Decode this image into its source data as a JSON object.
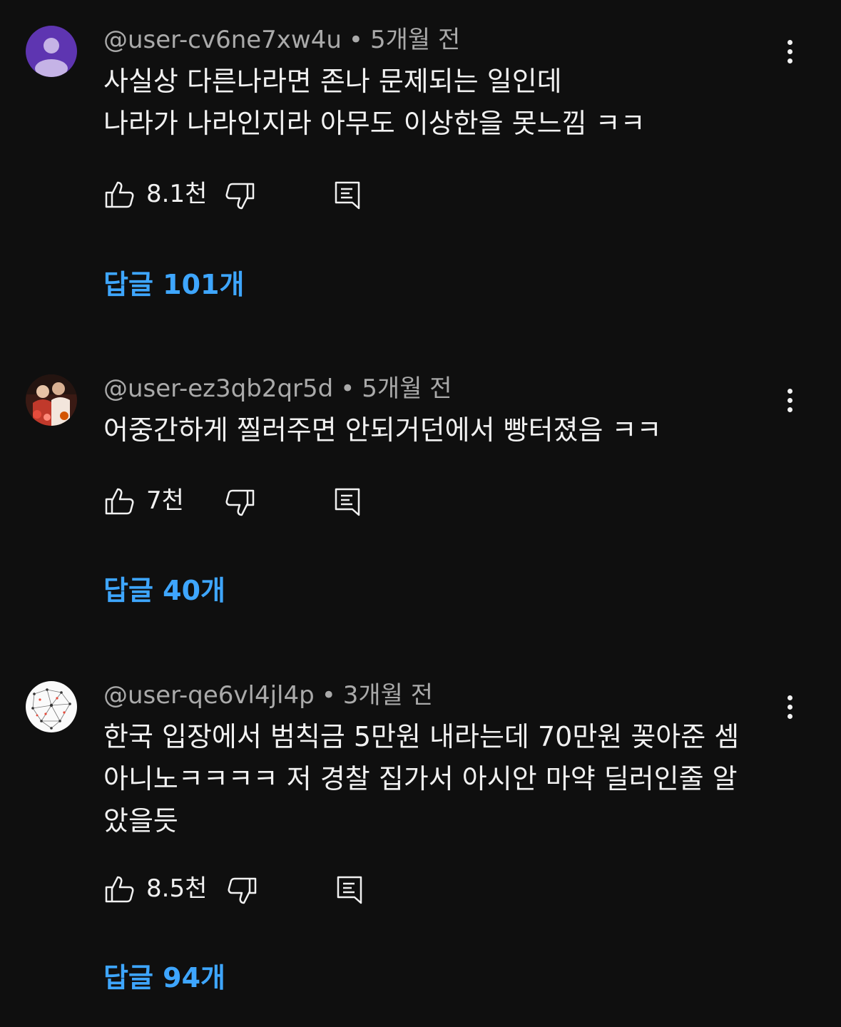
{
  "comments": [
    {
      "author": "@user-cv6ne7xw4u",
      "time": "5개월 전",
      "text": "사실상 다른나라면 존나 문제되는 일인데\n나라가 나라인지라 아무도 이상한을 못느낌 ㅋㅋ",
      "likes": "8.1천",
      "replies": "답글 101개",
      "avatar": "default-person-icon"
    },
    {
      "author": "@user-ez3qb2qr5d",
      "time": "5개월 전",
      "text": "어중간하게 찔러주면 안되거던에서 빵터졌음 ㅋㅋ",
      "likes": "7천",
      "replies": "답글 40개",
      "avatar": "photo-avatar"
    },
    {
      "author": "@user-qe6vl4jl4p",
      "time": "3개월 전",
      "text": "한국 입장에서 범칙금 5만원 내라는데 70만원 꽂아준 셈\n아니노ㅋㅋㅋㅋ 저 경찰 집가서 아시안 마약 딜러인줄 알\n았을듯",
      "likes": "8.5천",
      "replies": "답글 94개",
      "avatar": "network-pattern-avatar"
    }
  ],
  "colors": {
    "background": "#0f0f0f",
    "text": "#f1f1f1",
    "meta": "#aaaaaa",
    "reply_link": "#3ea6ff",
    "default_avatar": "#5e35b1"
  }
}
